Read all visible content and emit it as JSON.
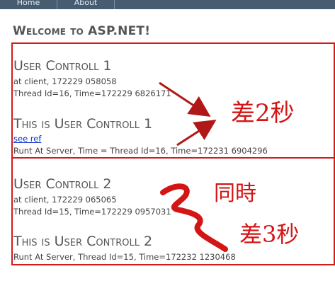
{
  "nav": {
    "home": "Home",
    "about": "About"
  },
  "page": {
    "title": "Welcome to ASP.NET!"
  },
  "control1": {
    "heading": "User Controll 1",
    "client_line": "at client, 172229 058058",
    "thread_line": "Thread Id=16, Time=172229 6826171",
    "server_heading": "This is User Controll 1",
    "link_text": "see ref",
    "server_line": "Runt At Server, Time = Thread Id=16, Time=172231 6904296"
  },
  "control2": {
    "heading": "User Controll 2",
    "client_line": "at client, 172229 065065",
    "thread_line": "Thread Id=15, Time=172229 0957031",
    "server_heading": "This is User Controll 2",
    "server_line": "Runt At Server, Thread Id=15, Time=172232 1230468"
  },
  "annotations": {
    "diff2": "差2秒",
    "same_time": "同時",
    "diff3": "差3秒",
    "color": "#d41515"
  }
}
